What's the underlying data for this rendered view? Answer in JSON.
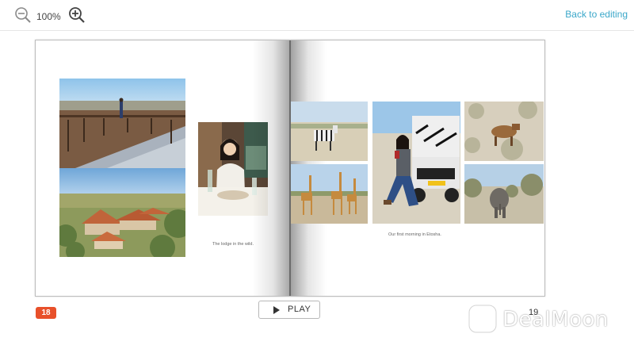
{
  "toolbar": {
    "zoom_level": "100%",
    "zoom_out_icon": "zoom-out-icon",
    "zoom_in_icon": "zoom-in-icon",
    "back_label": "Back to editing",
    "accent_color": "#3aa7c9"
  },
  "spread": {
    "left_page": {
      "caption": "The lodge in the wild.",
      "number": "18",
      "number_badge_color": "#e8502a",
      "photos": [
        "deck-view-photo",
        "lodge-rooftops-photo",
        "dinner-portrait-photo"
      ]
    },
    "right_page": {
      "caption": "Our first morning in Etosha.",
      "number": "19",
      "photos": [
        "zebras-photo",
        "safari-vehicle-portrait-photo",
        "hyena-photo",
        "giraffes-photo",
        "elephant-photo"
      ]
    }
  },
  "controls": {
    "play_label": "PLAY",
    "play_icon": "play-icon"
  },
  "watermark": {
    "text": "DealMoon"
  }
}
